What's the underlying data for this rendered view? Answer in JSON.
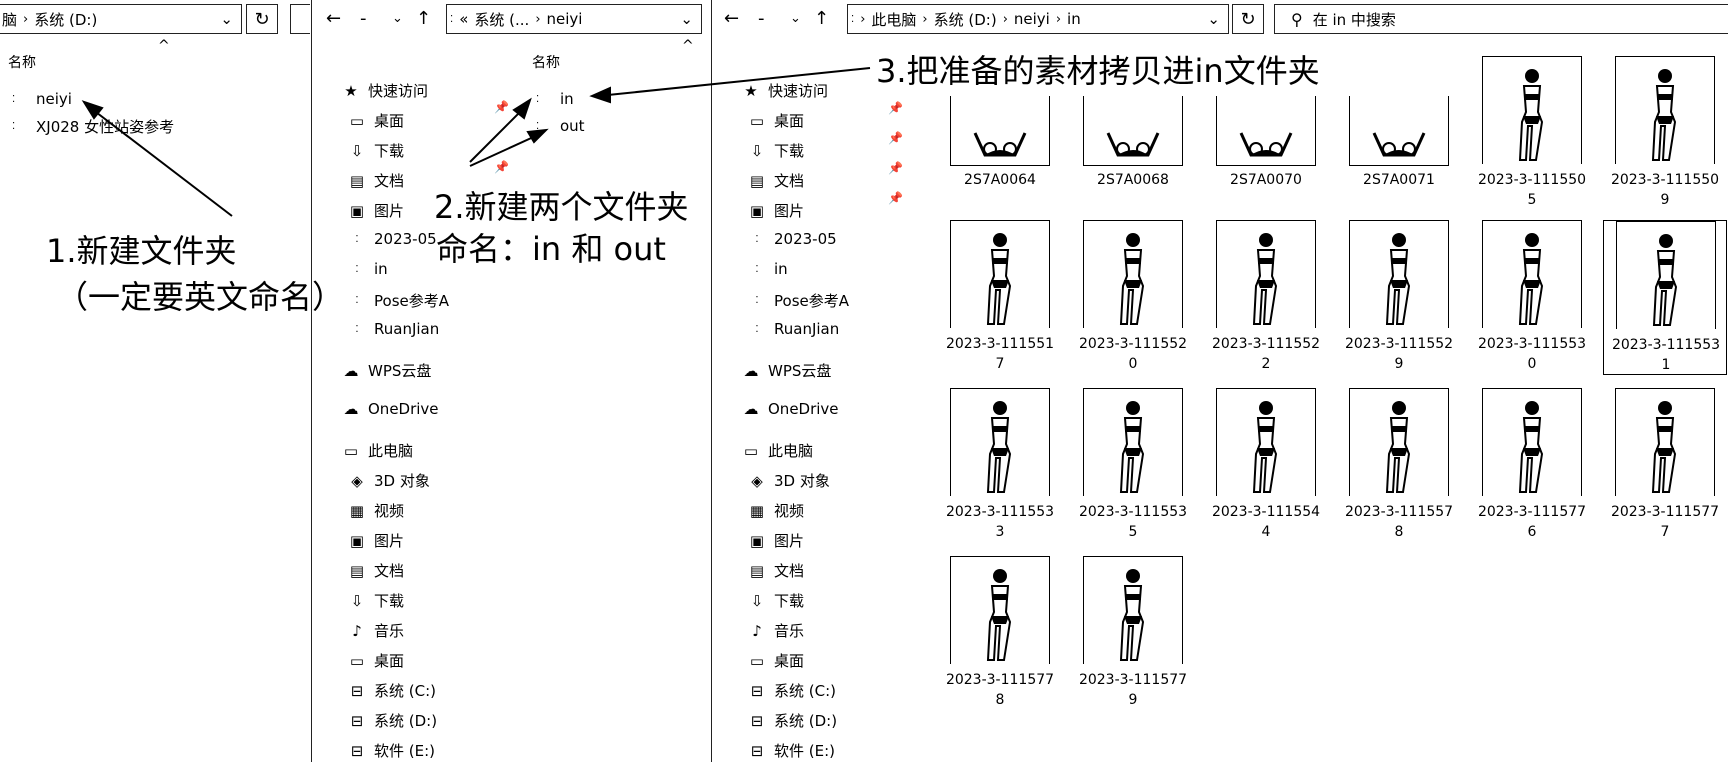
{
  "left": {
    "address": [
      "脑",
      "系统 (D:)"
    ],
    "column_name": "名称",
    "items": [
      {
        "label": "neiyi"
      },
      {
        "label": "XJ028 女性站姿参考"
      }
    ]
  },
  "mid": {
    "address": [
      "«",
      "系统 (...",
      "neiyi"
    ],
    "column_name": "名称",
    "nav": [
      {
        "label": "快速访问",
        "icon": "★"
      },
      {
        "label": "桌面",
        "icon": "▭"
      },
      {
        "label": "下载",
        "icon": "⇩"
      },
      {
        "label": "文档",
        "icon": "▤"
      },
      {
        "label": "图片",
        "icon": "▣"
      },
      {
        "label": "2023-05",
        "icon": "⁚"
      },
      {
        "label": "in",
        "icon": "⁚"
      },
      {
        "label": "Pose参考A",
        "icon": "⁚"
      },
      {
        "label": "RuanJian",
        "icon": "⁚"
      },
      {
        "label": "WPS云盘",
        "icon": "☁"
      },
      {
        "label": "OneDrive",
        "icon": "☁"
      },
      {
        "label": "此电脑",
        "icon": "▭"
      },
      {
        "label": "3D 对象",
        "icon": "◈"
      },
      {
        "label": "视频",
        "icon": "▦"
      },
      {
        "label": "图片",
        "icon": "▣"
      },
      {
        "label": "文档",
        "icon": "▤"
      },
      {
        "label": "下载",
        "icon": "⇩"
      },
      {
        "label": "音乐",
        "icon": "♪"
      },
      {
        "label": "桌面",
        "icon": "▭"
      },
      {
        "label": "系统 (C:)",
        "icon": "⊟"
      },
      {
        "label": "系统 (D:)",
        "icon": "⊟"
      },
      {
        "label": "软件 (E:)",
        "icon": "⊟"
      }
    ],
    "items": [
      {
        "label": "in"
      },
      {
        "label": "out"
      }
    ]
  },
  "right": {
    "address": [
      "此电脑",
      "系统 (D:)",
      "neiyi",
      "in"
    ],
    "search_placeholder": "在 in 中搜索",
    "nav": [
      {
        "label": "快速访问",
        "icon": "★"
      },
      {
        "label": "桌面",
        "icon": "▭"
      },
      {
        "label": "下载",
        "icon": "⇩"
      },
      {
        "label": "文档",
        "icon": "▤"
      },
      {
        "label": "图片",
        "icon": "▣"
      },
      {
        "label": "2023-05",
        "icon": "⁚"
      },
      {
        "label": "in",
        "icon": "⁚"
      },
      {
        "label": "Pose参考A",
        "icon": "⁚"
      },
      {
        "label": "RuanJian",
        "icon": "⁚"
      },
      {
        "label": "WPS云盘",
        "icon": "☁"
      },
      {
        "label": "OneDrive",
        "icon": "☁"
      },
      {
        "label": "此电脑",
        "icon": "▭"
      },
      {
        "label": "3D 对象",
        "icon": "◈"
      },
      {
        "label": "视频",
        "icon": "▦"
      },
      {
        "label": "图片",
        "icon": "▣"
      },
      {
        "label": "文档",
        "icon": "▤"
      },
      {
        "label": "下载",
        "icon": "⇩"
      },
      {
        "label": "音乐",
        "icon": "♪"
      },
      {
        "label": "桌面",
        "icon": "▭"
      },
      {
        "label": "系统 (C:)",
        "icon": "⊟"
      },
      {
        "label": "系统 (D:)",
        "icon": "⊟"
      },
      {
        "label": "软件 (E:)",
        "icon": "⊟"
      }
    ],
    "files": [
      {
        "name": [
          "2S7A0064"
        ],
        "kind": "square"
      },
      {
        "name": [
          "2S7A0068"
        ],
        "kind": "square"
      },
      {
        "name": [
          "2S7A0070"
        ],
        "kind": "square"
      },
      {
        "name": [
          "2S7A0071"
        ],
        "kind": "square"
      },
      {
        "name": [
          "2023-3-111550",
          "5"
        ],
        "kind": "portrait"
      },
      {
        "name": [
          "2023-3-111550",
          "9"
        ],
        "kind": "portrait"
      },
      {
        "name": [
          "2023-3-111551",
          "7"
        ],
        "kind": "portrait"
      },
      {
        "name": [
          "2023-3-111552",
          "0"
        ],
        "kind": "portrait"
      },
      {
        "name": [
          "2023-3-111552",
          "2"
        ],
        "kind": "portrait"
      },
      {
        "name": [
          "2023-3-111552",
          "9"
        ],
        "kind": "portrait"
      },
      {
        "name": [
          "2023-3-111553",
          "0"
        ],
        "kind": "portrait"
      },
      {
        "name": [
          "2023-3-111553",
          "1"
        ],
        "kind": "portrait",
        "selected": true
      },
      {
        "name": [
          "2023-3-111553",
          "3"
        ],
        "kind": "portrait"
      },
      {
        "name": [
          "2023-3-111553",
          "5"
        ],
        "kind": "portrait"
      },
      {
        "name": [
          "2023-3-111554",
          "4"
        ],
        "kind": "portrait"
      },
      {
        "name": [
          "2023-3-111557",
          "8"
        ],
        "kind": "portrait"
      },
      {
        "name": [
          "2023-3-111577",
          "6"
        ],
        "kind": "portrait"
      },
      {
        "name": [
          "2023-3-111577",
          "7"
        ],
        "kind": "portrait"
      },
      {
        "name": [
          "2023-3-111577",
          "8"
        ],
        "kind": "portrait"
      },
      {
        "name": [
          "2023-3-111577",
          "9"
        ],
        "kind": "portrait"
      }
    ]
  },
  "annotations": {
    "step1_line1": "1.新建文件夹",
    "step1_line2": "（一定要英文命名）",
    "step2_line1": "2.新建两个文件夹",
    "step2_line2": "命名：in 和 out",
    "step3": "3.把准备的素材拷贝进in文件夹"
  }
}
